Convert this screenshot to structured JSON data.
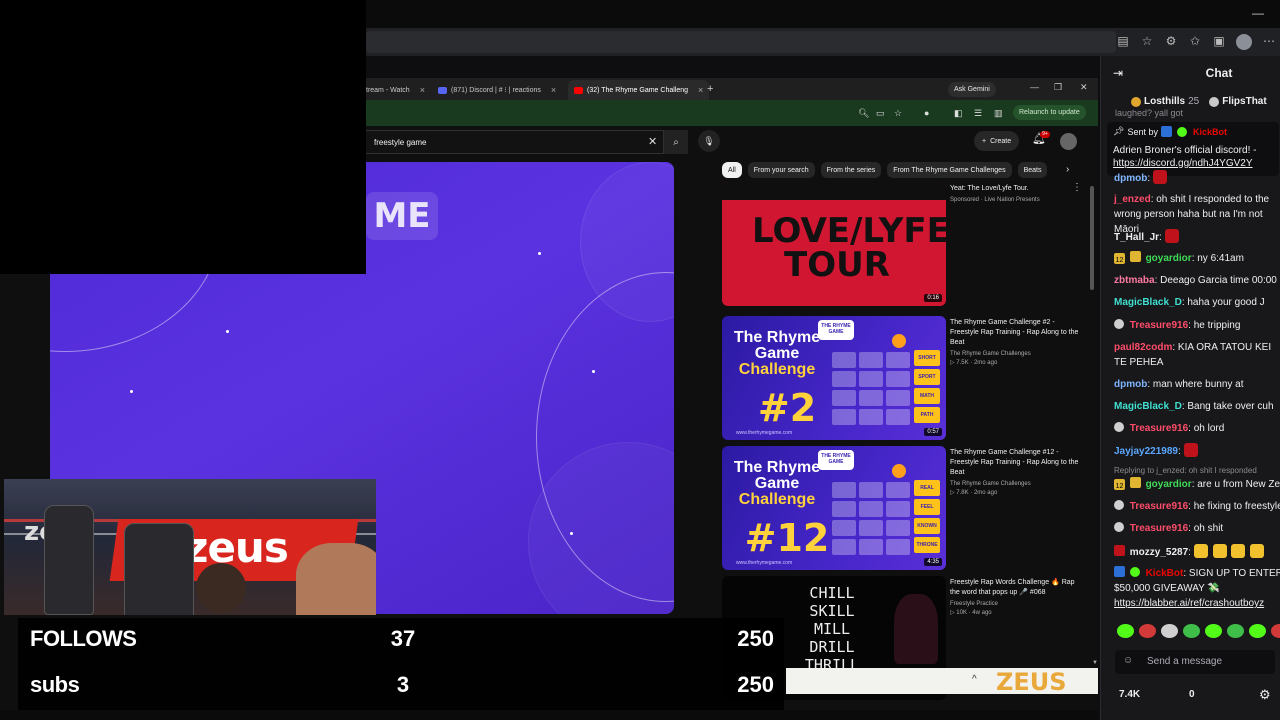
{
  "browser": {
    "tabs": [
      {
        "label": "tream - Watch",
        "close": "×",
        "favicon_color": "#9146ff"
      },
      {
        "label": "(871) Discord | # ⁝ | reactions",
        "close": "×",
        "favicon_color": "#5865f2"
      },
      {
        "label": "(32) The Rhyme Game Challeng",
        "close": "×",
        "favicon_color": "#ff0000"
      }
    ],
    "new_tab": "+",
    "ask_gemini": "Ask Gemini",
    "relaunch": "Relaunch to update",
    "window_controls": [
      "—",
      "❐",
      "✕"
    ]
  },
  "youtube": {
    "search_value": "freestyle game",
    "search_clear": "✕",
    "create_label": "Create",
    "notif_badge": "9+",
    "chips": [
      "All",
      "From your search",
      "From the series",
      "From The Rhyme Game Challenges",
      "Beats"
    ],
    "video_partial_text": "ME",
    "results": [
      {
        "title": "Yeat: The Love/Lyfe Tour.",
        "channel": "Sponsored · Live Nation Presents",
        "views": "",
        "duration": "0:16",
        "thumb_text": "LOVE/LYFE TOUR"
      },
      {
        "title": "The Rhyme Game Challenge #2 - Freestyle Rap Training - Rap Along to the Beat",
        "channel": "The Rhyme Game Challenges",
        "views": "▷ 7.5K · 2mo ago",
        "duration": "0:57",
        "thumb_head1": "The Rhyme Game",
        "thumb_head2": "Challenge",
        "thumb_num": "#2",
        "logo": "THE RHYME GAME",
        "words": [
          "SHORT",
          "SPORT",
          "MATH",
          "PATH"
        ],
        "url": "www.therhymegame.com"
      },
      {
        "title": "The Rhyme Game Challenge #12 - Freestyle Rap Training - Rap Along to the Beat",
        "channel": "The Rhyme Game Challenges",
        "views": "▷ 7.8K · 2mo ago",
        "duration": "4:35",
        "thumb_head1": "The Rhyme Game",
        "thumb_head2": "Challenge",
        "thumb_num": "#12",
        "logo": "THE RHYME GAME",
        "words": [
          "REAL",
          "FEEL",
          "KNOWN",
          "THRONE"
        ],
        "url": "www.therhymegame.com"
      },
      {
        "title": "Freestyle Rap Words Challenge 🔥 Rap the word that pops up 🎤 #068",
        "channel": "Freestyle Practice",
        "views": "▷ 10K · 4w ago",
        "thumb_text": "CHILL\nSKILL\nMILL\nDRILL\nTHRILL"
      }
    ]
  },
  "stream": {
    "webcam_brand": "zeus",
    "stats": [
      {
        "label": "FOLLOWS",
        "current": "37",
        "goal": "250"
      },
      {
        "label": "subs",
        "current": "3",
        "goal": "250"
      }
    ],
    "bottom_brand": "ZEUS",
    "bottom_caret": "^"
  },
  "chat": {
    "title": "Chat",
    "leaderboard": [
      {
        "name": "Losthills",
        "count": "25"
      },
      {
        "name": "FlipsThat",
        "count": ""
      }
    ],
    "partial_top": "laughed? yall got",
    "pinned": {
      "sent_by": "Sent by",
      "sender": "KickBot",
      "body": "Adrien Broner's official discord! -",
      "link": "https://discord.gg/ndhJ4YGV2Y"
    },
    "messages": [
      {
        "user": "dpmob",
        "color": "#7fb5ff",
        "text": ""
      },
      {
        "user": "j_enzed",
        "color": "#ff4d6a",
        "text": "oh shit I responded to the wrong person haha but na I'm not Māori"
      },
      {
        "user": "T_Hall_Jr",
        "color": "#efeff1",
        "text": ""
      },
      {
        "user": "goyardior",
        "color": "#3fdc57",
        "text": "ny 6:41am",
        "sub": "12"
      },
      {
        "user": "zbtmaba",
        "color": "#ff7aa2",
        "text": "Deeago Garcia time 00:00"
      },
      {
        "user": "MagicBlack_D",
        "color": "#3fe0d0",
        "text": "haha your good J"
      },
      {
        "user": "Treasure916",
        "color": "#ff4d6a",
        "text": "he tripping"
      },
      {
        "user": "paul82codm",
        "color": "#ff4d6a",
        "text": "KIA ORA TATOU KEI TE PEHEA"
      },
      {
        "user": "dpmob",
        "color": "#7fb5ff",
        "text": "man where bunny at"
      },
      {
        "user": "MagicBlack_D",
        "color": "#3fe0d0",
        "text": "Bang take over cuh"
      },
      {
        "user": "Treasure916",
        "color": "#ff4d6a",
        "text": "oh lord"
      },
      {
        "user": "Jayjay221989",
        "color": "#5aa8ff",
        "text": ""
      },
      {
        "reply_to": "Replying to j_enzed: oh shit I responded"
      },
      {
        "user": "goyardior",
        "color": "#3fdc57",
        "text": "are u from New Ze",
        "sub": "12"
      },
      {
        "user": "Treasure916",
        "color": "#ff4d6a",
        "text": "he fixing to freestyle"
      },
      {
        "user": "Treasure916",
        "color": "#ff4d6a",
        "text": "oh shit"
      },
      {
        "user": "mozzy_5287",
        "color": "#efeff1",
        "text": ""
      },
      {
        "user": "KickBot",
        "color": "#eb0400",
        "text": "SIGN UP TO ENTER $50,000 GIVEAWAY 💸",
        "link": "https://blabber.ai/ref/crashoutboyz"
      }
    ],
    "send_placeholder": "Send a message",
    "points": "7.4K",
    "zero": "0"
  }
}
